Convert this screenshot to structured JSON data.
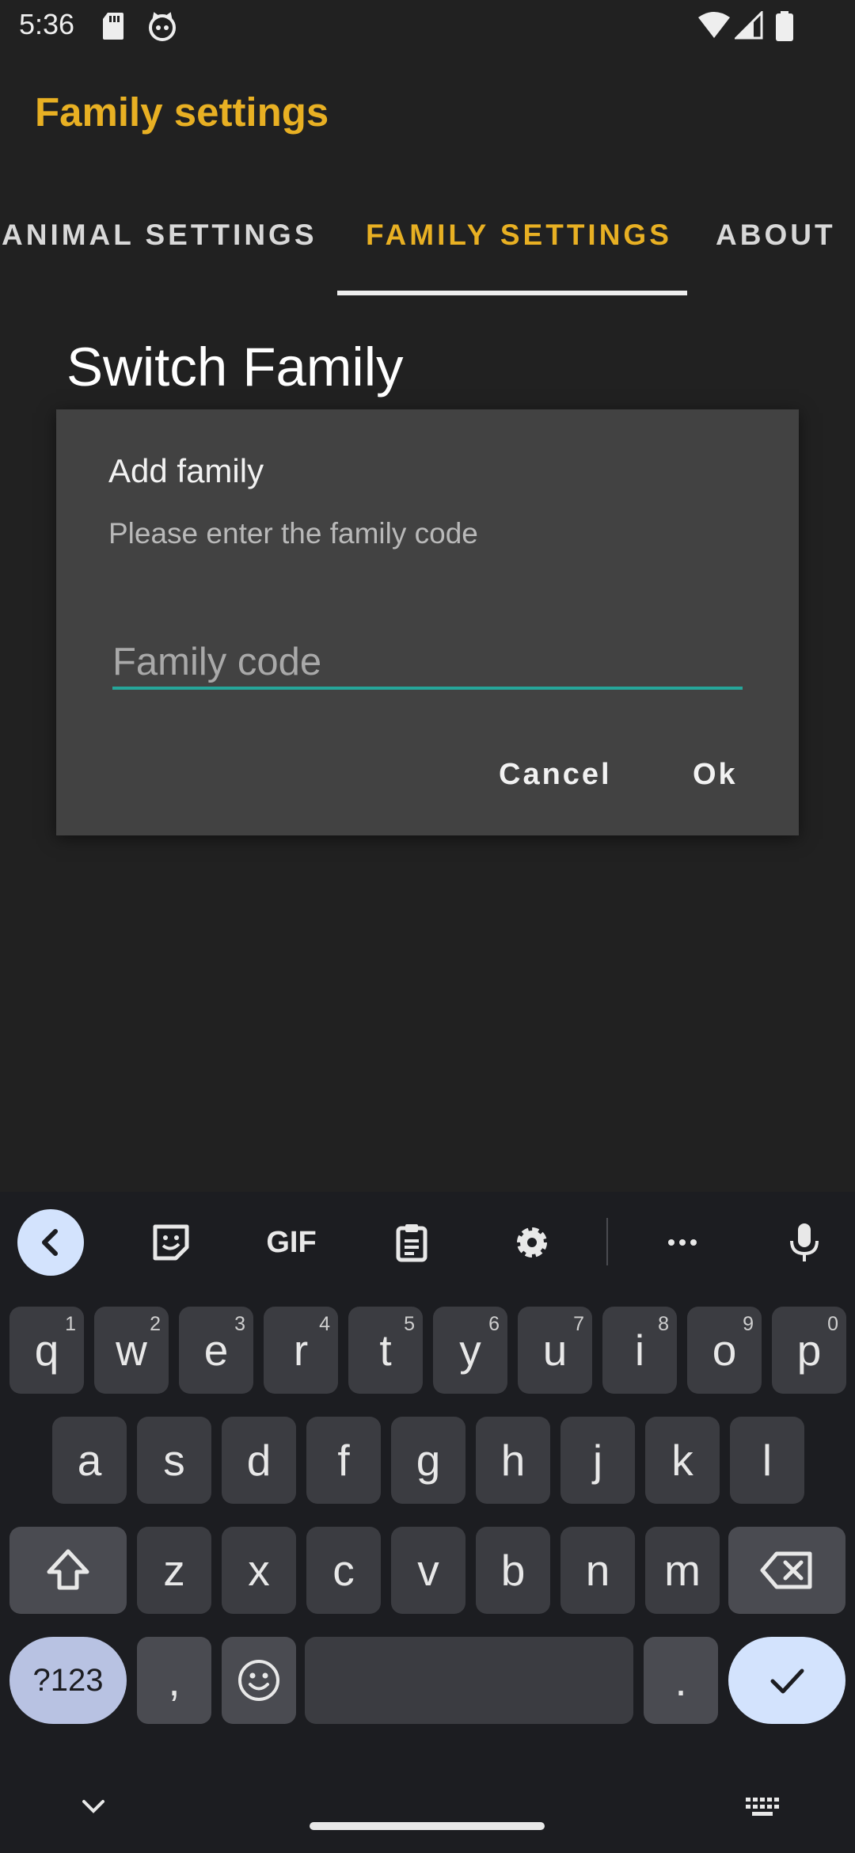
{
  "status_bar": {
    "time": "5:36",
    "icons": [
      "sd-card-icon",
      "cat-icon",
      "wifi-icon",
      "signal-icon",
      "battery-icon"
    ]
  },
  "app_bar": {
    "title": "Family settings"
  },
  "tabs": [
    {
      "label": "ANIMAL SETTINGS",
      "active": false
    },
    {
      "label": "FAMILY SETTINGS",
      "active": true
    },
    {
      "label": "ABOUT",
      "active": false
    }
  ],
  "section_title": "Switch Family",
  "dialog": {
    "title": "Add family",
    "message": "Please enter the family code",
    "input_placeholder": "Family code",
    "input_value": "",
    "cancel_label": "Cancel",
    "ok_label": "Ok"
  },
  "keyboard": {
    "toolbar_icons": [
      "back-chevron-icon",
      "sticker-icon",
      "gif-icon",
      "clipboard-icon",
      "settings-gear-icon",
      "more-dots-icon",
      "microphone-icon"
    ],
    "gif_label": "GIF",
    "row1": [
      {
        "k": "q",
        "h": "1"
      },
      {
        "k": "w",
        "h": "2"
      },
      {
        "k": "e",
        "h": "3"
      },
      {
        "k": "r",
        "h": "4"
      },
      {
        "k": "t",
        "h": "5"
      },
      {
        "k": "y",
        "h": "6"
      },
      {
        "k": "u",
        "h": "7"
      },
      {
        "k": "i",
        "h": "8"
      },
      {
        "k": "o",
        "h": "9"
      },
      {
        "k": "p",
        "h": "0"
      }
    ],
    "row2": [
      "a",
      "s",
      "d",
      "f",
      "g",
      "h",
      "j",
      "k",
      "l"
    ],
    "row3": [
      "z",
      "x",
      "c",
      "v",
      "b",
      "n",
      "m"
    ],
    "symbols_label": "?123",
    "comma_label": ",",
    "period_label": "."
  },
  "colors": {
    "accent": "#E8B023",
    "background": "#212121",
    "dialog": "#424242",
    "input_underline": "#26A69A",
    "keyboard_bg": "#1c1d21"
  }
}
